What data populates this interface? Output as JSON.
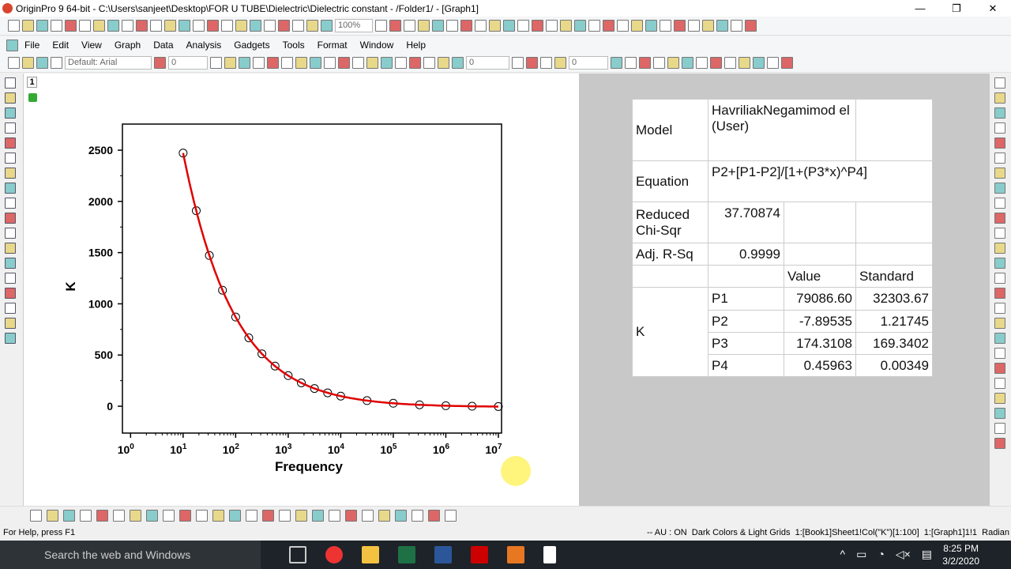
{
  "window": {
    "title": "OriginPro 9 64-bit - C:\\Users\\sanjeet\\Desktop\\FOR U TUBE\\Dielectric\\Dielectric constant - /Folder1/ - [Graph1]",
    "controls": [
      "—",
      "❐",
      "✕"
    ]
  },
  "toolbar": {
    "zoom": "100%",
    "font": "Default: Arial",
    "font_size": "0",
    "line_width": "0",
    "pattern_size": "0"
  },
  "menu": [
    "File",
    "Edit",
    "View",
    "Graph",
    "Data",
    "Analysis",
    "Gadgets",
    "Tools",
    "Format",
    "Window",
    "Help"
  ],
  "graph": {
    "layer_label": "1"
  },
  "chart_data": {
    "type": "scatter",
    "xlabel": "Frequency",
    "ylabel": "K",
    "xscale": "log",
    "xlim": [
      0.7,
      11500000
    ],
    "ylim": [
      -262,
      2755
    ],
    "xticks": [
      "10^0",
      "10^1",
      "10^2",
      "10^3",
      "10^4",
      "10^5",
      "10^6",
      "10^7"
    ],
    "yticks": [
      0,
      500,
      1000,
      1500,
      2000,
      2500
    ],
    "grid": false,
    "legend": "none",
    "marker_color": "#000000",
    "fit_color": "#e00000",
    "points": [
      [
        10,
        2472
      ],
      [
        17.8,
        1909
      ],
      [
        31.6,
        1472
      ],
      [
        56.2,
        1133
      ],
      [
        100,
        871
      ],
      [
        178,
        668
      ],
      [
        316,
        512
      ],
      [
        562,
        392
      ],
      [
        1000,
        299
      ],
      [
        1778,
        228
      ],
      [
        3162,
        173
      ],
      [
        5623,
        131
      ],
      [
        10000,
        99
      ],
      [
        31623,
        55
      ],
      [
        100000,
        29
      ],
      [
        316228,
        14
      ],
      [
        1000000,
        5
      ],
      [
        3162278,
        0
      ],
      [
        10000000,
        -3
      ]
    ],
    "fit": {
      "P1": 79086.6,
      "P2": -7.89535,
      "P3": 174.3108,
      "P4": 0.45963
    }
  },
  "fit_table": {
    "model_label": "Model",
    "model_value": "HavriliakNegamimod el (User)",
    "equation_label": "Equation",
    "equation_value": "P2+[P1-P2]/[1+(P3*x)^P4]",
    "chisq_label": "Reduced Chi-Sqr",
    "chisq_value": "37.70874",
    "r2_label": "Adj. R-Sq",
    "r2_value": "0.9999",
    "col_value": "Value",
    "col_std": "Standard",
    "group": "K",
    "params": [
      {
        "name": "P1",
        "value": "79086.60",
        "std": "32303.67"
      },
      {
        "name": "P2",
        "value": "-7.89535",
        "std": "1.21745"
      },
      {
        "name": "P3",
        "value": "174.3108",
        "std": "169.3402"
      },
      {
        "name": "P4",
        "value": "0.45963",
        "std": "0.00349"
      }
    ]
  },
  "status": {
    "help": "For Help, press F1",
    "right": "-- AU : ON  Dark Colors & Light Grids  1:[Book1]Sheet1!Col(\"K\")[1:100]  1:[Graph1]1!1  Radian"
  },
  "taskbar": {
    "search": "Search the web and Windows",
    "time": "8:25 PM",
    "date": "3/2/2020"
  }
}
